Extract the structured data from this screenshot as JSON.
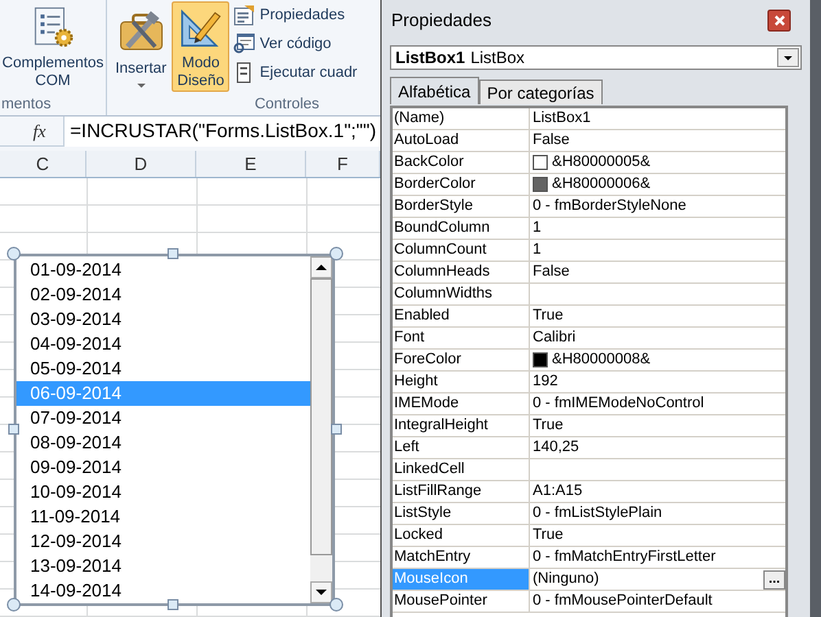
{
  "ribbon": {
    "groups": [
      {
        "label": "mentos",
        "buttons": [
          {
            "kind": "large",
            "label": "Complementos COM",
            "selected": false
          }
        ]
      },
      {
        "label": "Controles",
        "buttons": [
          {
            "kind": "large",
            "label": "Insertar",
            "dropdown": true,
            "selected": false
          },
          {
            "kind": "large",
            "label": "Modo Diseño",
            "selected": true
          },
          {
            "kind": "small",
            "label": "Propiedades",
            "selected": false
          },
          {
            "kind": "small",
            "label": "Ver código",
            "selected": false
          },
          {
            "kind": "small",
            "label": "Ejecutar cuadr",
            "selected": false
          }
        ]
      }
    ]
  },
  "formula_bar": {
    "fx": "fx",
    "formula": "=INCRUSTAR(\"Forms.ListBox.1\";\"\")"
  },
  "sheet": {
    "columns": [
      "C",
      "D",
      "E",
      "F"
    ]
  },
  "listbox": {
    "items": [
      {
        "label": "01-09-2014",
        "selected": false
      },
      {
        "label": "02-09-2014",
        "selected": false
      },
      {
        "label": "03-09-2014",
        "selected": false
      },
      {
        "label": "04-09-2014",
        "selected": false
      },
      {
        "label": "05-09-2014",
        "selected": false
      },
      {
        "label": "06-09-2014",
        "selected": true
      },
      {
        "label": "07-09-2014",
        "selected": false
      },
      {
        "label": "08-09-2014",
        "selected": false
      },
      {
        "label": "09-09-2014",
        "selected": false
      },
      {
        "label": "10-09-2014",
        "selected": false
      },
      {
        "label": "11-09-2014",
        "selected": false
      },
      {
        "label": "12-09-2014",
        "selected": false
      },
      {
        "label": "13-09-2014",
        "selected": false
      },
      {
        "label": "14-09-2014",
        "selected": false
      }
    ]
  },
  "properties_window": {
    "title": "Propiedades",
    "object_name": "ListBox1",
    "object_type": "ListBox",
    "tabs": [
      {
        "label": "Alfabética",
        "selected": true
      },
      {
        "label": "Por categorías",
        "selected": false
      }
    ],
    "rows": [
      {
        "kind": "text",
        "name": "(Name)",
        "value": "ListBox1",
        "selected": false
      },
      {
        "kind": "text",
        "name": "AutoLoad",
        "value": "False",
        "selected": false
      },
      {
        "kind": "color",
        "name": "BackColor",
        "value": "&H80000005&",
        "color": "#ffffff",
        "selected": false
      },
      {
        "kind": "color",
        "name": "BorderColor",
        "value": "&H80000006&",
        "color": "#646464",
        "selected": false
      },
      {
        "kind": "text",
        "name": "BorderStyle",
        "value": "0 - fmBorderStyleNone",
        "selected": false
      },
      {
        "kind": "text",
        "name": "BoundColumn",
        "value": "1",
        "selected": false
      },
      {
        "kind": "text",
        "name": "ColumnCount",
        "value": "1",
        "selected": false
      },
      {
        "kind": "text",
        "name": "ColumnHeads",
        "value": "False",
        "selected": false
      },
      {
        "kind": "text",
        "name": "ColumnWidths",
        "selected": false
      },
      {
        "kind": "text",
        "name": "Enabled",
        "value": "True",
        "selected": false
      },
      {
        "kind": "text",
        "name": "Font",
        "value": "Calibri",
        "selected": false
      },
      {
        "kind": "color",
        "name": "ForeColor",
        "value": "&H80000008&",
        "color": "#000000",
        "selected": false
      },
      {
        "kind": "text",
        "name": "Height",
        "value": "192",
        "selected": false
      },
      {
        "kind": "text",
        "name": "IMEMode",
        "value": "0 - fmIMEModeNoControl",
        "selected": false
      },
      {
        "kind": "text",
        "name": "IntegralHeight",
        "value": "True",
        "selected": false
      },
      {
        "kind": "text",
        "name": "Left",
        "value": "140,25",
        "selected": false
      },
      {
        "kind": "text",
        "name": "LinkedCell",
        "selected": false
      },
      {
        "kind": "text",
        "name": "ListFillRange",
        "value": "A1:A15",
        "selected": false
      },
      {
        "kind": "text",
        "name": "ListStyle",
        "value": "0 - fmListStylePlain",
        "selected": false
      },
      {
        "kind": "text",
        "name": "Locked",
        "value": "True",
        "selected": false
      },
      {
        "kind": "text",
        "name": "MatchEntry",
        "value": "0 - fmMatchEntryFirstLetter",
        "selected": false
      },
      {
        "kind": "picker",
        "name": "MouseIcon",
        "value": "(Ninguno)",
        "button": "...",
        "selected": true
      },
      {
        "kind": "text",
        "name": "MousePointer",
        "value": "0 - fmMousePointerDefault",
        "selected": false
      }
    ]
  }
}
